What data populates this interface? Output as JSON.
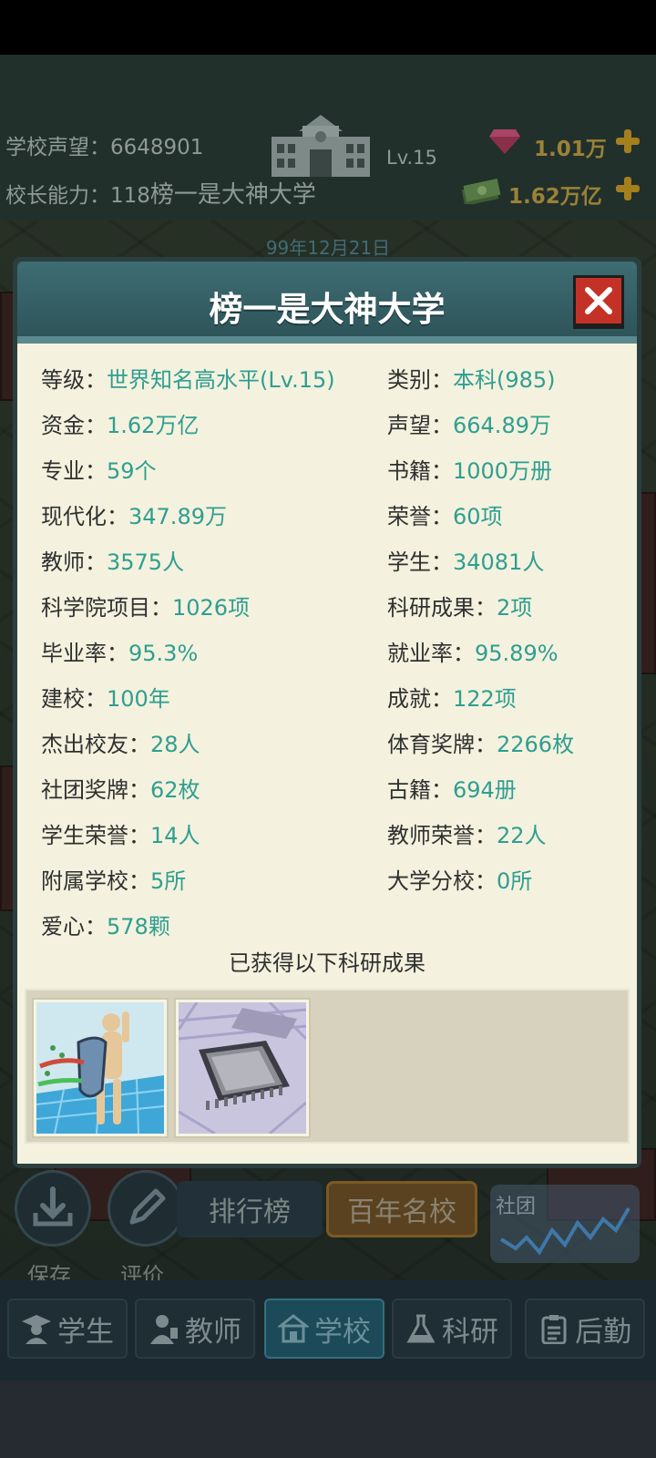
{
  "hud": {
    "reputation_label": "学校声望：",
    "reputation_value": "6648901",
    "principal_label": "校长能力：",
    "principal_value": "118",
    "school_name": "榜一是大神大学",
    "level": "Lv.15",
    "gems": "1.01万",
    "money": "1.62万亿",
    "date": "99年12月21日"
  },
  "modal": {
    "title": "榜一是大神大学",
    "close_icon": "close-x-icon",
    "info_left": [
      {
        "label": "等级：",
        "value": "世界知名高水平(Lv.15)"
      },
      {
        "label": "资金：",
        "value": "1.62万亿"
      },
      {
        "label": "专业：",
        "value": "59个"
      },
      {
        "label": "现代化：",
        "value": "347.89万"
      },
      {
        "label": "教师：",
        "value": "3575人"
      },
      {
        "label": "科学院项目：",
        "value": "1026项"
      },
      {
        "label": "毕业率：",
        "value": "95.3%"
      },
      {
        "label": "建校：",
        "value": "100年"
      },
      {
        "label": "杰出校友：",
        "value": "28人"
      },
      {
        "label": "社团奖牌：",
        "value": "62枚"
      },
      {
        "label": "学生荣誉：",
        "value": "14人"
      },
      {
        "label": "附属学校：",
        "value": "5所"
      },
      {
        "label": "爱心：",
        "value": "578颗"
      }
    ],
    "info_right": [
      {
        "label": "类别：",
        "value": "本科(985)"
      },
      {
        "label": "声望：",
        "value": "664.89万"
      },
      {
        "label": "书籍：",
        "value": "1000万册"
      },
      {
        "label": "荣誉：",
        "value": "60项"
      },
      {
        "label": "学生：",
        "value": "34081人"
      },
      {
        "label": "科研成果：",
        "value": "2项"
      },
      {
        "label": "就业率：",
        "value": "95.89%"
      },
      {
        "label": "成就：",
        "value": "122项"
      },
      {
        "label": "体育奖牌：",
        "value": "2266枚"
      },
      {
        "label": "古籍：",
        "value": "694册"
      },
      {
        "label": "教师荣誉：",
        "value": "22人"
      },
      {
        "label": "大学分校：",
        "value": "0所"
      }
    ],
    "results_heading": "已获得以下科研成果",
    "results": [
      {
        "icon": "immune-shield-research-icon"
      },
      {
        "icon": "microchip-research-icon"
      }
    ]
  },
  "under_controls": {
    "save_label": "保存",
    "review_label": "评价",
    "ranking_tab": "排行榜",
    "famous_tab": "百年名校",
    "club_label": "社团"
  },
  "bottom_nav": {
    "items": [
      {
        "label": "学生",
        "icon": "student-icon"
      },
      {
        "label": "教师",
        "icon": "teacher-icon"
      },
      {
        "label": "学校",
        "icon": "school-icon",
        "active": true
      },
      {
        "label": "科研",
        "icon": "flask-icon"
      },
      {
        "label": "后勤",
        "icon": "clipboard-icon"
      }
    ]
  },
  "colors": {
    "accent_value": "#2f9e91",
    "title_bar": "#3e6d73",
    "close_button": "#c43227",
    "panel_bg": "#f4f2de"
  }
}
